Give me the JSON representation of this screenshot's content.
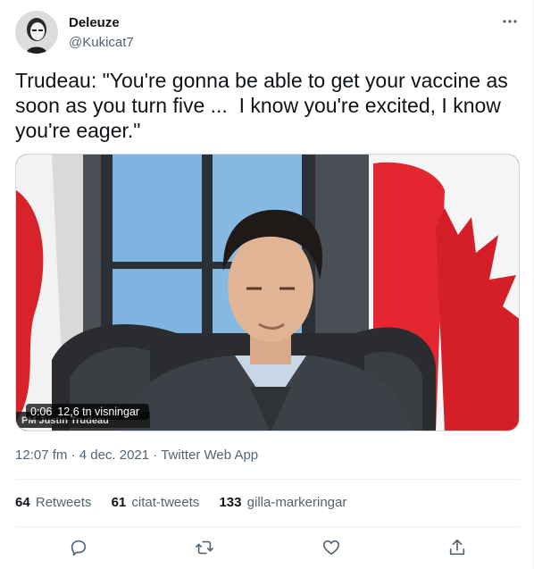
{
  "author": {
    "display_name": "Deleuze",
    "handle": "@Kukicat7"
  },
  "more_icon": "more-horizontal-icon",
  "tweet": {
    "text": "Trudeau: \"You're gonna be able to get your vaccine as soon as you turn five ...  I know you're excited, I know you're eager.\""
  },
  "media": {
    "duration": "0:06",
    "views": "12,6 tn visningar",
    "caption_overlay": "PM Justin Trudeau"
  },
  "meta": {
    "time": "12:07 fm",
    "separator": " · ",
    "date": "4 dec. 2021",
    "source": "Twitter Web App"
  },
  "stats": {
    "retweets_count": "64",
    "retweets_label": "Retweets",
    "quotes_count": "61",
    "quotes_label": "citat-tweets",
    "likes_count": "133",
    "likes_label": "gilla-markeringar"
  },
  "actions": [
    "reply-icon",
    "retweet-icon",
    "like-icon",
    "share-icon"
  ],
  "colors": {
    "text_primary": "#0f1419",
    "text_secondary": "#536471",
    "border": "#eff3f4"
  }
}
